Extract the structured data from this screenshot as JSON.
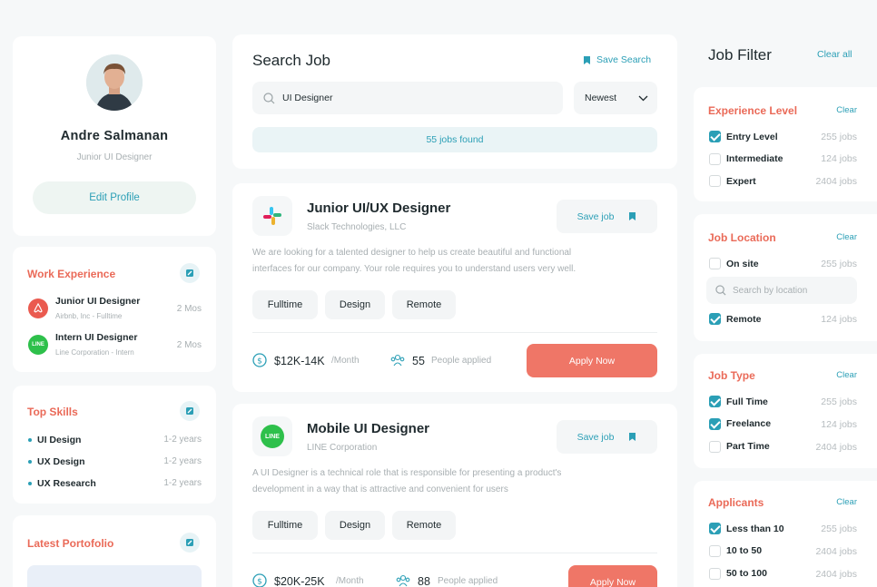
{
  "profile": {
    "name": "Andre Salmanan",
    "role": "Junior UI Designer",
    "edit_label": "Edit Profile"
  },
  "work_experience": {
    "title": "Work Experience",
    "items": [
      {
        "title": "Junior UI Designer",
        "company": "Airbnb, Inc - Fulltime",
        "duration": "2 Mos",
        "logo": "airbnb-logo"
      },
      {
        "title": "Intern UI Designer",
        "company": "Line Corporation - Intern",
        "duration": "2 Mos",
        "logo": "line-logo"
      }
    ]
  },
  "top_skills": {
    "title": "Top Skills",
    "items": [
      {
        "name": "UI Design",
        "years": "1-2 years"
      },
      {
        "name": "UX Design",
        "years": "1-2 years"
      },
      {
        "name": "UX Research",
        "years": "1-2 years"
      }
    ]
  },
  "portfolio": {
    "title": "Latest Portofolio"
  },
  "search": {
    "title": "Search Job",
    "save_label": "Save Search",
    "query": "UI Designer",
    "sort": "Newest",
    "found": "55 jobs found"
  },
  "jobs": [
    {
      "title": "Junior UI/UX Designer",
      "company": "Slack Technologies, LLC",
      "save_label": "Save job",
      "desc1": "We are looking for a talented designer to help us create beautiful and functional",
      "desc2": "interfaces for our company. Your role requires you to understand users very well.",
      "tags": [
        "Fulltime",
        "Design",
        "Remote"
      ],
      "salary": "$12K-14K",
      "period": "/Month",
      "applied": "55",
      "applied_label": "People applied",
      "apply_label": "Apply Now"
    },
    {
      "title": "Mobile UI Designer",
      "company": "LINE Corporation",
      "save_label": "Save job",
      "desc1": "A UI Designer is a technical role that is responsible for presenting a product's",
      "desc2": "development in a way that is attractive and convenient for users",
      "tags": [
        "Fulltime",
        "Design",
        "Remote"
      ],
      "salary": "$20K-25K",
      "period": "/Month",
      "applied": "88",
      "applied_label": "People applied",
      "apply_label": "Apply Now",
      "logo_text": "LINE"
    }
  ],
  "filter": {
    "title": "Job Filter",
    "clear_all": "Clear all",
    "clear": "Clear",
    "experience": {
      "title": "Experience Level",
      "options": [
        {
          "label": "Entry Level",
          "count": "255 jobs",
          "checked": true
        },
        {
          "label": "Intermediate",
          "count": "124 jobs",
          "checked": false
        },
        {
          "label": "Expert",
          "count": "2404 jobs",
          "checked": false
        }
      ]
    },
    "location": {
      "title": "Job Location",
      "placeholder": "Search by location",
      "options": [
        {
          "label": "On site",
          "count": "255 jobs",
          "checked": false
        },
        {
          "label": "Remote",
          "count": "124 jobs",
          "checked": true
        }
      ]
    },
    "job_type": {
      "title": "Job Type",
      "options": [
        {
          "label": "Full Time",
          "count": "255 jobs",
          "checked": true
        },
        {
          "label": "Freelance",
          "count": "124 jobs",
          "checked": true
        },
        {
          "label": "Part Time",
          "count": "2404 jobs",
          "checked": false
        }
      ]
    },
    "applicants": {
      "title": "Applicants",
      "options": [
        {
          "label": "Less than 10",
          "count": "255 jobs",
          "checked": true
        },
        {
          "label": "10 to 50",
          "count": "2404 jobs",
          "checked": false
        },
        {
          "label": "50 to 100",
          "count": "2404 jobs",
          "checked": false
        }
      ]
    }
  },
  "colors": {
    "accent": "#ea6a58",
    "primary": "#2b9fb6",
    "apply": "#ef7667"
  }
}
